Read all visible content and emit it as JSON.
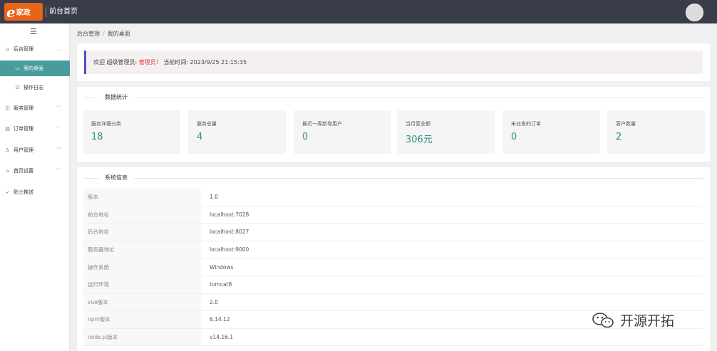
{
  "header": {
    "logo_mark": "e",
    "logo_text": "家政",
    "title": "前台首页"
  },
  "sidebar": {
    "toggle_icon": "menu-icon",
    "items": [
      {
        "label": "后台管理",
        "icon": "home-icon",
        "expandable": true
      },
      {
        "label": "我的桌面",
        "icon": "monitor-icon",
        "active": true
      },
      {
        "label": "操作日志",
        "icon": "log-icon"
      },
      {
        "label": "服务管理",
        "icon": "service-icon",
        "expandable": true
      },
      {
        "label": "订单管理",
        "icon": "order-icon",
        "expandable": true
      },
      {
        "label": "用户管理",
        "icon": "user-icon",
        "expandable": true
      },
      {
        "label": "首页设置",
        "icon": "home-settings-icon",
        "expandable": true
      },
      {
        "label": "贴士推送",
        "icon": "send-icon",
        "expandable": false
      }
    ]
  },
  "breadcrumb": {
    "root": "后台管理",
    "separator": "/",
    "current": "我的桌面"
  },
  "welcome": {
    "prefix": "欢迎 超级管理员: ",
    "role": "管理员",
    "suffix": "！ 当前时间: 2023/9/25 21:15:35"
  },
  "stats": {
    "title": "数据统计",
    "items": [
      {
        "label": "服务详细分类",
        "value": "18"
      },
      {
        "label": "服务总量",
        "value": "4"
      },
      {
        "label": "最近一周新增用户",
        "value": "0"
      },
      {
        "label": "当月营业额",
        "value": "306元"
      },
      {
        "label": "未派发的订单",
        "value": "0"
      },
      {
        "label": "客户数量",
        "value": "2"
      }
    ]
  },
  "system": {
    "title": "系统信息",
    "rows": [
      {
        "key": "版本",
        "value": "1.0"
      },
      {
        "key": "前台地址",
        "value": "localhost:7028"
      },
      {
        "key": "后台地址",
        "value": "localhost:8027"
      },
      {
        "key": "服务器地址",
        "value": "localhost:9000"
      },
      {
        "key": "操作系统",
        "value": "Windows"
      },
      {
        "key": "运行环境",
        "value": "tomcat8"
      },
      {
        "key": "vue版本",
        "value": "2.0"
      },
      {
        "key": "npm版本",
        "value": "6.14.12"
      },
      {
        "key": "node.js版本",
        "value": "v14.16.1"
      }
    ]
  },
  "watermark": {
    "text": "开源开拓",
    "icon": "wechat-icon"
  },
  "colors": {
    "topbar": "#393d49",
    "accent": "#4a9b9b",
    "logo": "#e96318",
    "stat_value": "#2f8f83",
    "role_highlight": "#e03a3a",
    "welcome_border": "#5050c8"
  }
}
